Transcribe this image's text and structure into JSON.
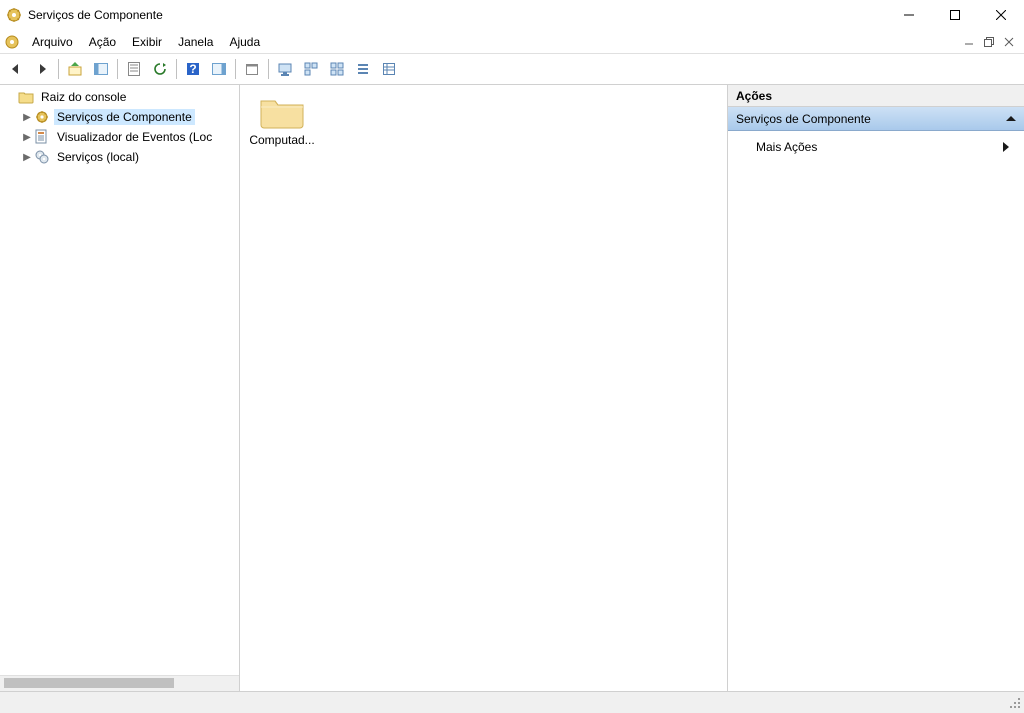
{
  "title": "Serviços de Componente",
  "menu": {
    "arquivo": "Arquivo",
    "acao": "Ação",
    "exibir": "Exibir",
    "janela": "Janela",
    "ajuda": "Ajuda"
  },
  "tree": {
    "root": "Raiz do console",
    "items": [
      {
        "label": "Serviços de Componente"
      },
      {
        "label": "Visualizador de Eventos (Loc"
      },
      {
        "label": "Serviços (local)"
      }
    ]
  },
  "main": {
    "computers": "Computad..."
  },
  "actions": {
    "header": "Ações",
    "section": "Serviços de Componente",
    "more": "Mais Ações"
  }
}
